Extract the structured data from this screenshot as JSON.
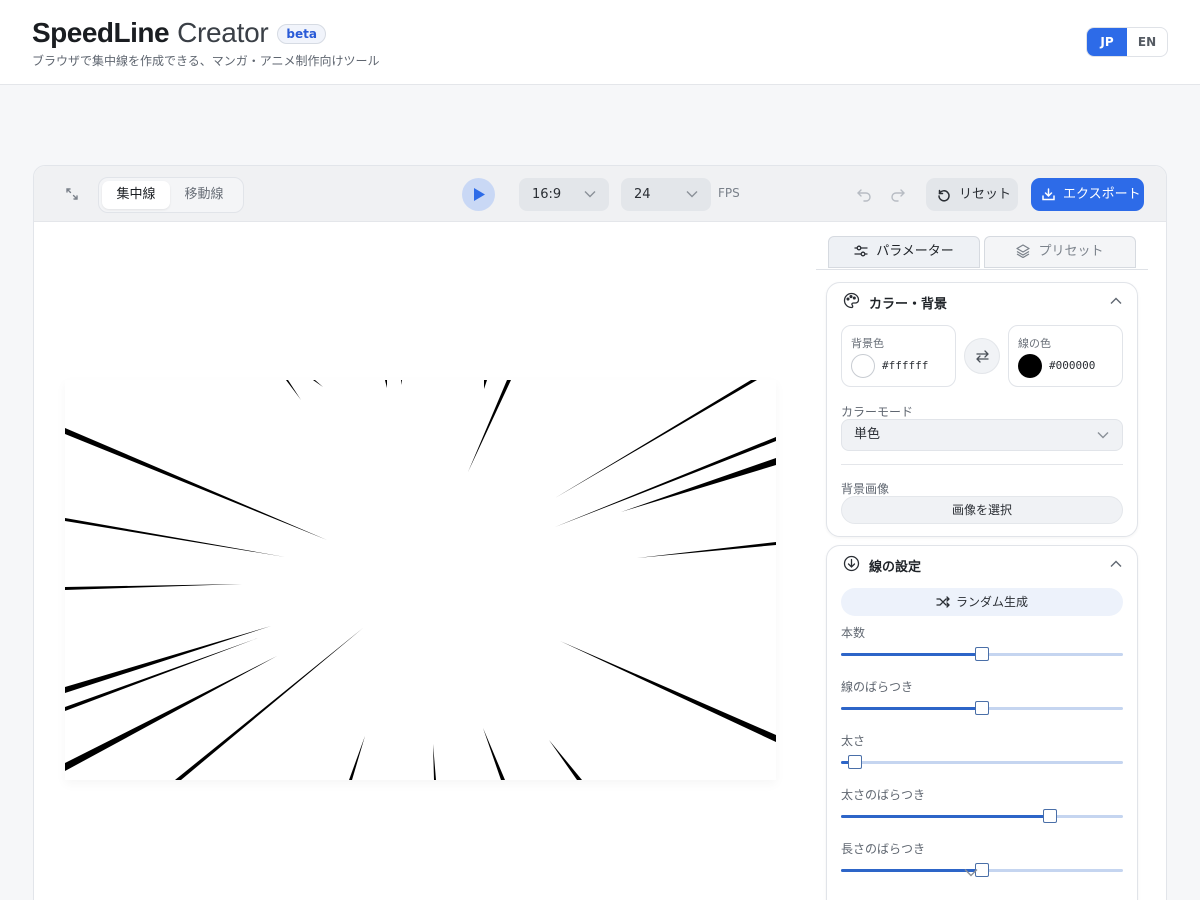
{
  "header": {
    "logo_bold": "SpeedLine",
    "logo_light": "Creator",
    "badge": "beta",
    "tagline": "ブラウザで集中線を作成できる、マンガ・アニメ制作向けツール",
    "lang": [
      "JP",
      "EN"
    ],
    "lang_active": "JP"
  },
  "toolbar": {
    "modes": [
      "集中線",
      "移動線"
    ],
    "active_mode": "集中線",
    "aspect_ratio": "16:9",
    "fps_value": "24",
    "fps_label": "FPS",
    "reset_label": "リセット",
    "export_label": "エクスポート"
  },
  "panel": {
    "tabs": [
      "パラメーター",
      "プリセット"
    ],
    "active_tab": "パラメーター",
    "color_section": {
      "title": "カラー・背景",
      "bg_color_label": "背景色",
      "bg_color_value": "#ffffff",
      "line_color_label": "線の色",
      "line_color_value": "#000000",
      "color_mode_label": "カラーモード",
      "color_mode_value": "単色",
      "bg_image_label": "背景画像",
      "bg_image_button": "画像を選択"
    },
    "line_section": {
      "title": "線の設定",
      "random_button": "ランダム生成",
      "sliders": [
        {
          "label": "本数",
          "value": 0.5
        },
        {
          "label": "線のばらつき",
          "value": 0.5
        },
        {
          "label": "太さ",
          "value": 0.05
        },
        {
          "label": "太さのばらつき",
          "value": 0.74
        },
        {
          "label": "長さのばらつき",
          "value": 0.5
        }
      ]
    }
  },
  "colors": {
    "accent": "#2d6be8",
    "slider_fill": "#2d65c8",
    "slider_track": "#c5d5f0"
  },
  "icons": [
    "expand-icon",
    "play-icon",
    "chevron-down-icon",
    "undo-icon",
    "redo-icon",
    "reset-icon",
    "export-icon",
    "sliders-icon",
    "layers-icon",
    "palette-icon",
    "swap-icon",
    "line-settings-icon",
    "shuffle-icon",
    "chevron-up-icon"
  ]
}
